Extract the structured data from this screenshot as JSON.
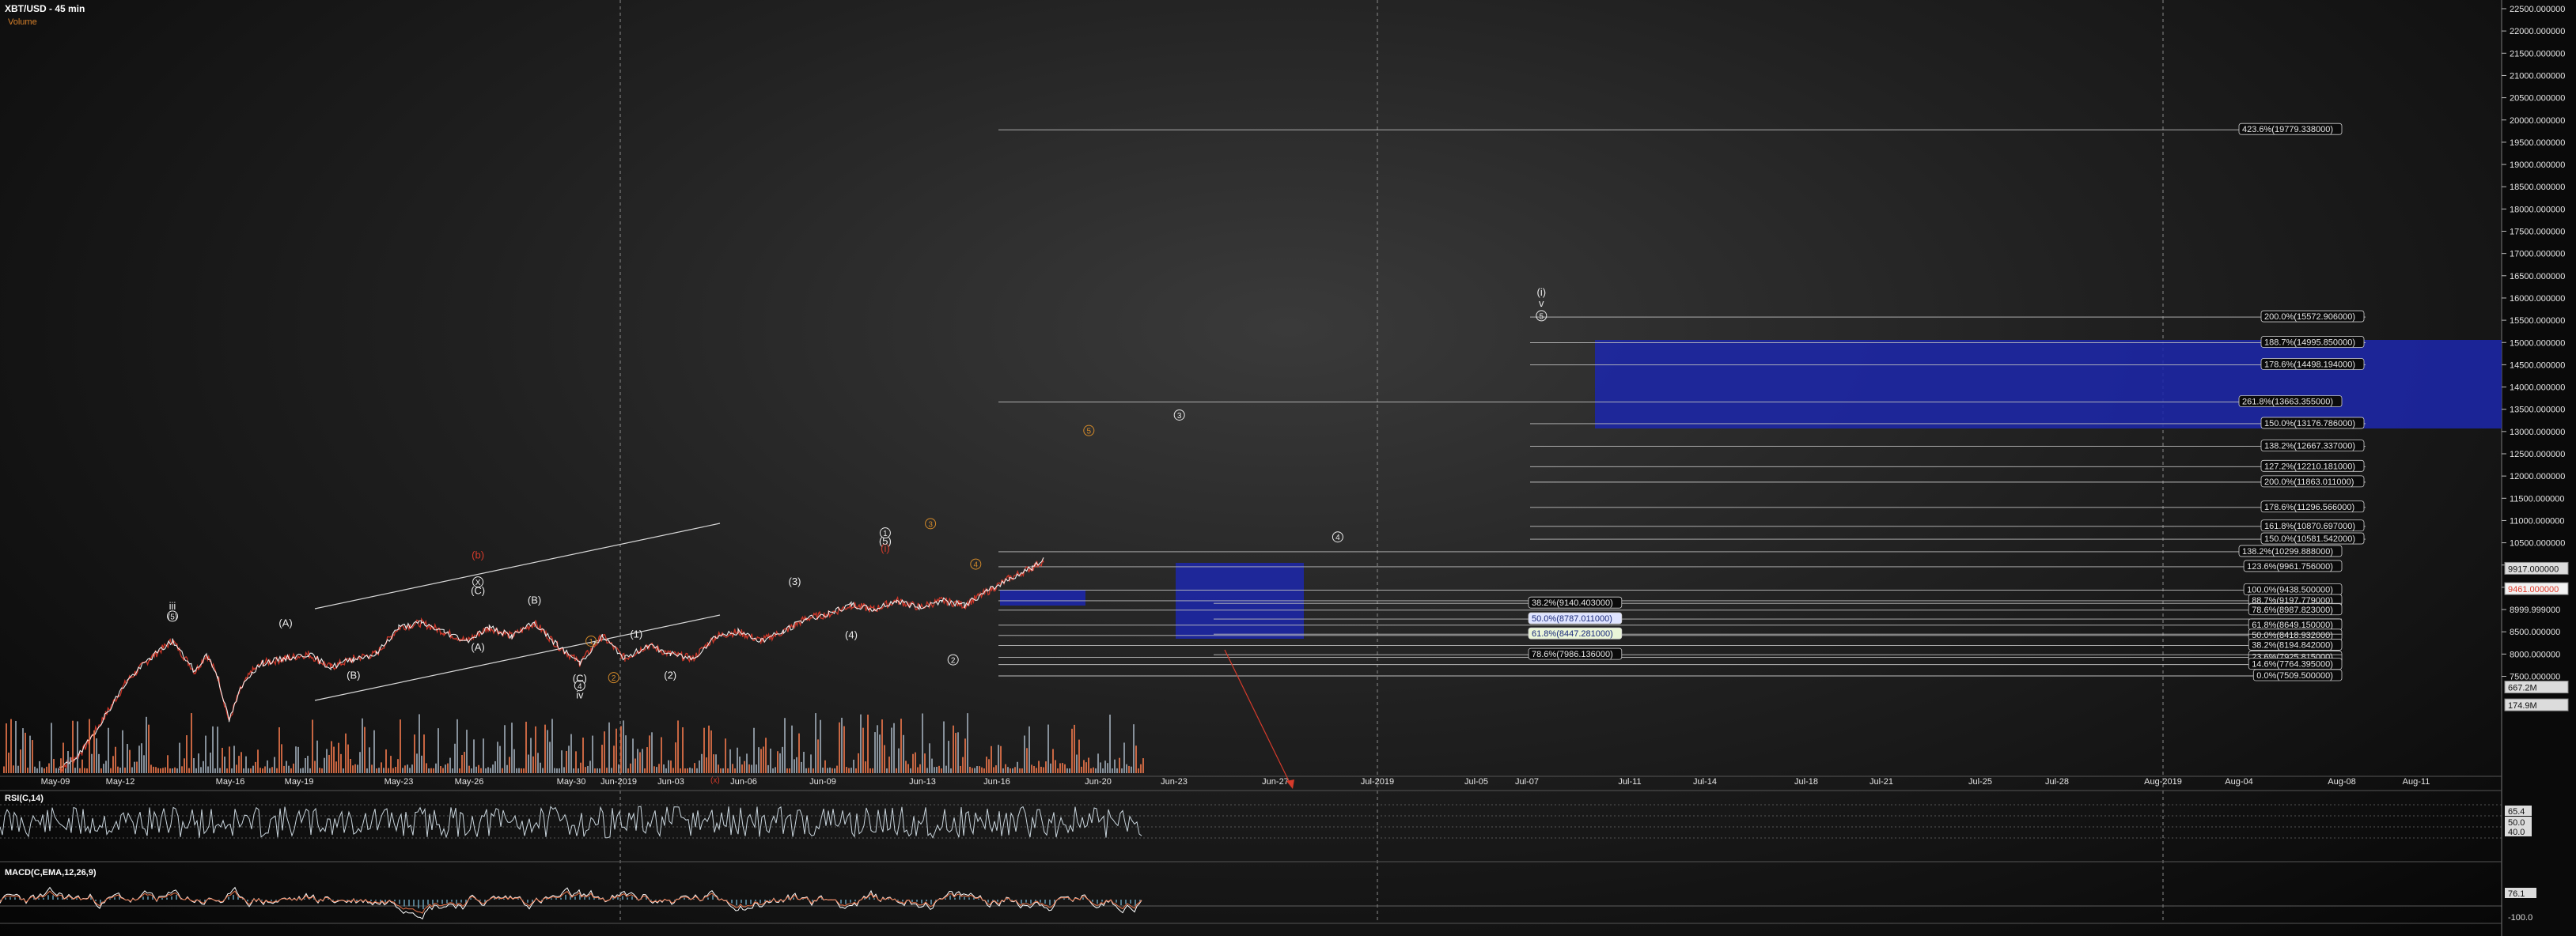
{
  "header": {
    "title": "XBT/USD - 45 min",
    "subtitle": "Volume"
  },
  "colors": {
    "up": "#ffffff",
    "down": "#e03a2a",
    "volume_up": "#9aa6b2",
    "volume_down": "#e8744a",
    "box": "#1d27a8",
    "accent": "#d38a2a",
    "red_label": "#d63b2b",
    "rsi_line": "#c8d4dc"
  },
  "chart_data": {
    "type": "line",
    "title": "XBT/USD - 45 min",
    "ylim": [
      7000,
      22500
    ],
    "y_ticks": [
      "22500.000000",
      "22000.000000",
      "21500.000000",
      "21000.000000",
      "20500.000000",
      "20000.000000",
      "19500.000000",
      "19000.000000",
      "18500.000000",
      "18000.000000",
      "17500.000000",
      "17000.000000",
      "16500.000000",
      "16000.000000",
      "15500.000000",
      "15000.000000",
      "14500.000000",
      "14000.000000",
      "13500.000000",
      "13000.000000",
      "12500.000000",
      "12000.000000",
      "11500.000000",
      "11000.000000",
      "10500.000000",
      "10000.000000",
      "9500.000000",
      "8999.999000",
      "8500.000000",
      "8000.000000",
      "7500.000000"
    ],
    "x_ticks": [
      "May-09",
      "May-12",
      "May-16",
      "May-19",
      "May-23",
      "May-26",
      "May-30",
      "Jun-2019",
      "Jun-03",
      "Jun-06",
      "Jun-09",
      "Jun-13",
      "Jun-16",
      "Jun-20",
      "Jun-23",
      "Jun-27",
      "Jul-2019",
      "Jul-05",
      "Jul-07",
      "Jul-11",
      "Jul-14",
      "Jul-18",
      "Jul-21",
      "Jul-25",
      "Jul-28",
      "Aug-2019",
      "Aug-04",
      "Aug-08",
      "Aug-11"
    ],
    "price_path": [
      [
        0,
        5400
      ],
      [
        2,
        5800
      ],
      [
        4,
        6600
      ],
      [
        6,
        7400
      ],
      [
        8,
        7900
      ],
      [
        10,
        8300
      ],
      [
        12,
        7600
      ],
      [
        13,
        8000
      ],
      [
        14,
        7500
      ],
      [
        15,
        6500
      ],
      [
        16,
        7200
      ],
      [
        17,
        7600
      ],
      [
        18,
        7800
      ],
      [
        20,
        7900
      ],
      [
        22,
        8000
      ],
      [
        24,
        7700
      ],
      [
        26,
        7900
      ],
      [
        28,
        8000
      ],
      [
        30,
        8600
      ],
      [
        32,
        8700
      ],
      [
        34,
        8500
      ],
      [
        36,
        8300
      ],
      [
        38,
        8600
      ],
      [
        40,
        8400
      ],
      [
        42,
        8700
      ],
      [
        44,
        8200
      ],
      [
        46,
        7800
      ],
      [
        48,
        8400
      ],
      [
        50,
        7900
      ],
      [
        52,
        8200
      ],
      [
        54,
        8000
      ],
      [
        56,
        7900
      ],
      [
        58,
        8400
      ],
      [
        60,
        8500
      ],
      [
        62,
        8300
      ],
      [
        64,
        8500
      ],
      [
        66,
        8800
      ],
      [
        68,
        8900
      ],
      [
        70,
        9100
      ],
      [
        72,
        9000
      ],
      [
        74,
        9200
      ],
      [
        76,
        9050
      ],
      [
        78,
        9200
      ],
      [
        80,
        9100
      ],
      [
        82,
        9400
      ],
      [
        84,
        9700
      ],
      [
        86,
        9950
      ],
      [
        87,
        10100
      ]
    ],
    "price_labels": [
      {
        "text": "9917.000000",
        "value": 9917
      },
      {
        "text": "9461.000000",
        "value": 9461
      },
      {
        "text": "667.2M",
        "value": 7250
      },
      {
        "text": "174.9M",
        "value": 6850
      }
    ],
    "fib_block_1": [
      {
        "text": "423.6%(19779.338000)",
        "value": 19779
      },
      {
        "text": "261.8%(13663.355000)",
        "value": 13663
      },
      {
        "text": "138.2%(10299.888000)",
        "value": 10299
      },
      {
        "text": "123.6%(9961.756000)",
        "value": 9961
      },
      {
        "text": "100.0%(9438.500000)",
        "value": 9438
      },
      {
        "text": "88.7%(9197.779000)",
        "value": 9197
      },
      {
        "text": "78.6%(8987.823000)",
        "value": 8987
      },
      {
        "text": "61.8%(8649.150000)",
        "value": 8649
      },
      {
        "text": "50.0%(8418.932000)",
        "value": 8418
      },
      {
        "text": "38.2%(8194.842000)",
        "value": 8194
      },
      {
        "text": "23.6%(7925.815000)",
        "value": 7925
      },
      {
        "text": "14.6%(7764.395000)",
        "value": 7764
      },
      {
        "text": "0.0%(7509.500000)",
        "value": 7509
      }
    ],
    "fib_block_2": [
      {
        "text": "200.0%(15572.906000)",
        "value": 15572
      },
      {
        "text": "188.7%(14995.850000)",
        "value": 14995
      },
      {
        "text": "178.6%(14498.194000)",
        "value": 14498
      },
      {
        "text": "150.0%(13176.786000)",
        "value": 13176
      },
      {
        "text": "138.2%(12667.337000)",
        "value": 12667
      },
      {
        "text": "127.2%(12210.181000)",
        "value": 12210
      },
      {
        "text": "200.0%(11863.011000)",
        "value": 11863
      },
      {
        "text": "178.6%(11296.566000)",
        "value": 11296
      },
      {
        "text": "161.8%(10870.697000)",
        "value": 10870
      },
      {
        "text": "150.0%(10581.542000)",
        "value": 10581
      }
    ],
    "fib_block_3": [
      {
        "text": "38.2%(9140.403000)",
        "value": 9140
      },
      {
        "text": "50.0%(8787.011000)",
        "value": 8787
      },
      {
        "text": "61.8%(8447.281000)",
        "value": 8447
      },
      {
        "text": "78.6%(7986.136000)",
        "value": 7986
      }
    ],
    "wave_labels": [
      {
        "text": "iii",
        "day": 10,
        "value": 9000,
        "color": "white"
      },
      {
        "text": "(5)",
        "day": 10,
        "value": 8780,
        "color": "white",
        "circle": true
      },
      {
        "text": "(A)",
        "day": 20,
        "value": 8620,
        "color": "white"
      },
      {
        "text": "(B)",
        "day": 26,
        "value": 7450,
        "color": "white"
      },
      {
        "text": "(B)",
        "day": 42,
        "value": 9130,
        "color": "white"
      },
      {
        "text": "X",
        "day": 37,
        "value": 9550,
        "color": "white",
        "circle": true
      },
      {
        "text": "(C)",
        "day": 37,
        "value": 9350,
        "color": "white"
      },
      {
        "text": "(A)",
        "day": 37,
        "value": 8080,
        "color": "white"
      },
      {
        "text": "(b)",
        "day": 37,
        "value": 10150,
        "color": "red"
      },
      {
        "text": "(C)",
        "day": 46,
        "value": 7380,
        "color": "white"
      },
      {
        "text": "4",
        "day": 46,
        "value": 7220,
        "color": "white",
        "circle": true
      },
      {
        "text": "iv",
        "day": 46,
        "value": 7000,
        "color": "white"
      },
      {
        "text": "1",
        "day": 47,
        "value": 8220,
        "color": "orange",
        "circle": true
      },
      {
        "text": "2",
        "day": 49,
        "value": 7400,
        "color": "orange",
        "circle": true
      },
      {
        "text": "(1)",
        "day": 51,
        "value": 8370,
        "color": "white"
      },
      {
        "text": "(2)",
        "day": 54,
        "value": 7450,
        "color": "white"
      },
      {
        "text": "(3)",
        "day": 65,
        "value": 9550,
        "color": "white"
      },
      {
        "text": "(4)",
        "day": 70,
        "value": 8350,
        "color": "white"
      },
      {
        "text": "1",
        "day": 73,
        "value": 10650,
        "color": "white",
        "circle": true
      },
      {
        "text": "(5)",
        "day": 73,
        "value": 10460,
        "color": "white"
      },
      {
        "text": "(i)",
        "day": 73,
        "value": 10300,
        "color": "red"
      },
      {
        "text": "3",
        "day": 77,
        "value": 10860,
        "color": "orange",
        "circle": true
      },
      {
        "text": "4",
        "day": 81,
        "value": 9950,
        "color": "orange",
        "circle": true
      },
      {
        "text": "2",
        "day": 79,
        "value": 7800,
        "color": "white",
        "circle": true
      },
      {
        "text": "5",
        "day": 91,
        "value": 12950,
        "color": "orange",
        "circle": true
      },
      {
        "text": "3",
        "day": 99,
        "value": 13300,
        "color": "white",
        "circle": true
      },
      {
        "text": "4",
        "day": 113,
        "value": 10560,
        "color": "white",
        "circle": true
      },
      {
        "text": "(i)",
        "day": 131,
        "value": 16050,
        "color": "white"
      },
      {
        "text": "v",
        "day": 131,
        "value": 15800,
        "color": "white"
      },
      {
        "text": "5",
        "day": 131,
        "value": 15530,
        "color": "white",
        "circle": true
      }
    ],
    "rsi": {
      "title": "RSI(C,14)",
      "labels": [
        "65.4",
        "50.0",
        "40.0"
      ]
    },
    "macd": {
      "title": "MACD(C,EMA,12,26,9)",
      "labels": [
        "76.1",
        "-100.0"
      ]
    },
    "annotation_arrow_label": "(x)"
  }
}
